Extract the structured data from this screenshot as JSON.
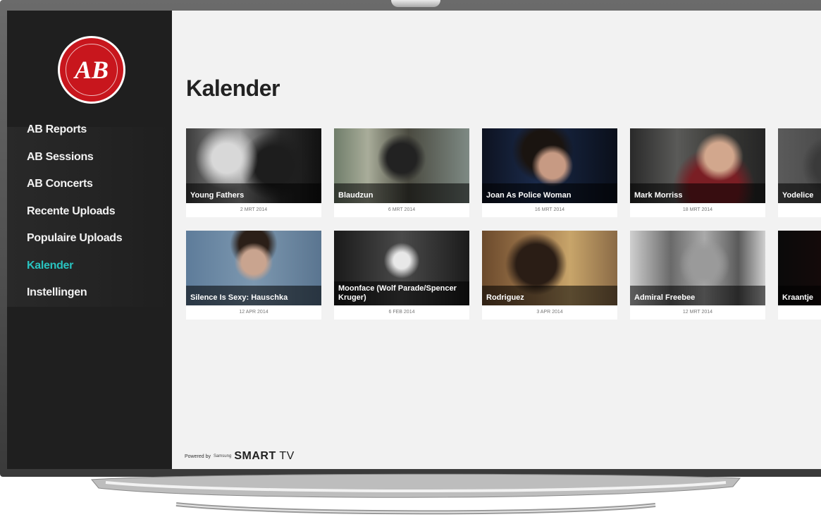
{
  "sidebar": {
    "logo_text": "AB",
    "items": [
      {
        "label": "AB Reports",
        "active": false
      },
      {
        "label": "AB Sessions",
        "active": false
      },
      {
        "label": "AB Concerts",
        "active": false
      },
      {
        "label": "Recente Uploads",
        "active": false
      },
      {
        "label": "Populaire Uploads",
        "active": false
      },
      {
        "label": "Kalender",
        "active": true
      },
      {
        "label": "Instellingen",
        "active": false
      }
    ],
    "powered_by": "Powered by",
    "samsung": "Samsung",
    "smart_tv_a": "SMART",
    "smart_tv_b": " TV"
  },
  "main": {
    "title": "Kalender",
    "rows": [
      [
        {
          "title": "Young Fathers",
          "date": "2 MRT 2014"
        },
        {
          "title": "Blaudzun",
          "date": "6 MRT 2014"
        },
        {
          "title": "Joan As Police Woman",
          "date": "16 MRT 2014"
        },
        {
          "title": "Mark Morriss",
          "date": "18 MRT 2014"
        },
        {
          "title": "Yodelice",
          "date": ""
        }
      ],
      [
        {
          "title": "Silence Is Sexy: Hauschka",
          "date": "12 APR 2014"
        },
        {
          "title": "Moonface (Wolf Parade/Spencer Kruger)",
          "date": "6 FEB 2014"
        },
        {
          "title": "Rodriguez",
          "date": "3 APR 2014"
        },
        {
          "title": "Admiral Freebee",
          "date": "12 MRT 2014"
        },
        {
          "title": "Kraantje",
          "date": ""
        }
      ]
    ]
  },
  "colors": {
    "accent": "#29c3c0",
    "sidebar_bg": "#1f1f1f",
    "logo_red": "#c8161d"
  }
}
